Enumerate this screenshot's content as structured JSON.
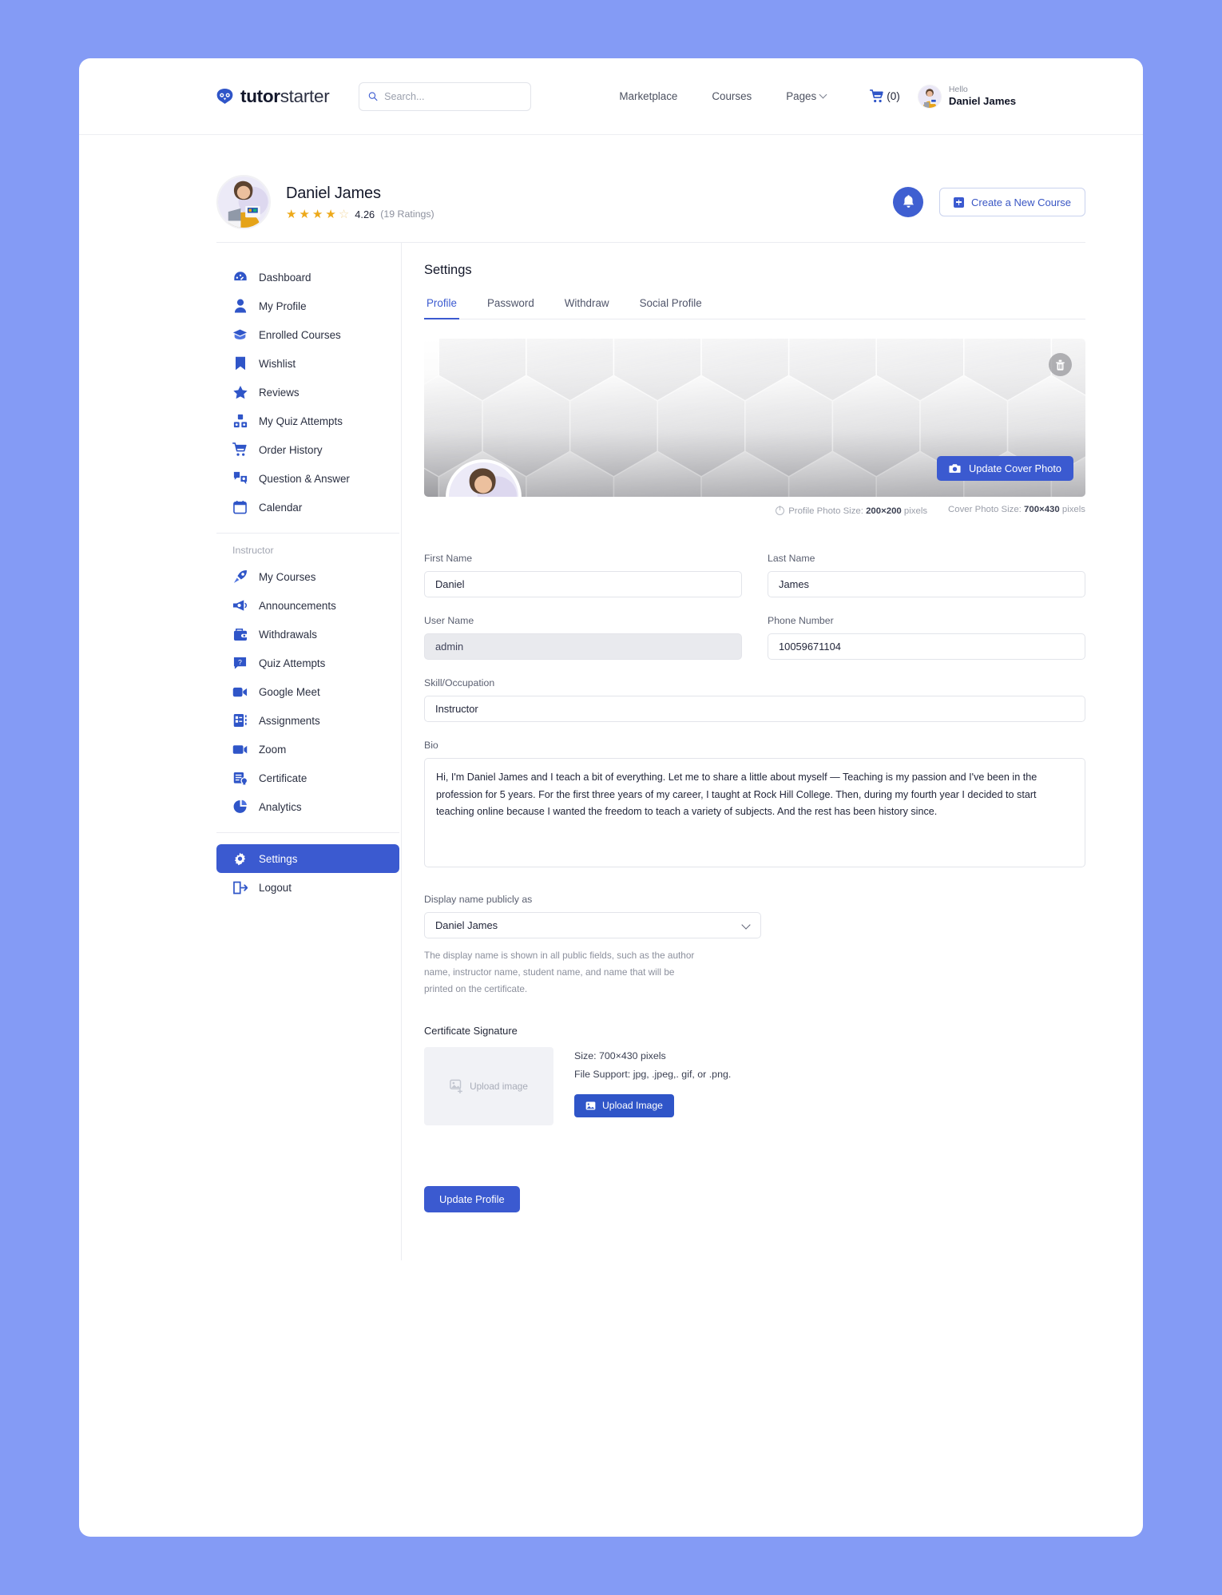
{
  "brand": {
    "bold": "tutor",
    "light": "starter",
    "icon": "owl-logo-icon"
  },
  "search": {
    "placeholder": "Search...",
    "value": ""
  },
  "nav": {
    "links": [
      {
        "label": "Marketplace",
        "has_caret": false
      },
      {
        "label": "Courses",
        "has_caret": false
      },
      {
        "label": "Pages",
        "has_caret": true
      }
    ],
    "cart_label": "(0)",
    "hello": "Hello",
    "user_name": "Daniel James"
  },
  "profile_header": {
    "name": "Daniel James",
    "rating_value": "4.26",
    "rating_count": "(19 Ratings)",
    "stars_filled": 4,
    "stars_total": 5,
    "notification_icon": "bell-icon",
    "create_course_label": "Create a New Course"
  },
  "sidebar": {
    "student_items": [
      {
        "label": "Dashboard",
        "icon": "dashboard-icon"
      },
      {
        "label": "My Profile",
        "icon": "user-icon"
      },
      {
        "label": "Enrolled Courses",
        "icon": "graduation-cap-icon"
      },
      {
        "label": "Wishlist",
        "icon": "bookmark-icon"
      },
      {
        "label": "Reviews",
        "icon": "star-icon"
      },
      {
        "label": "My Quiz Attempts",
        "icon": "quiz-icon"
      },
      {
        "label": "Order History",
        "icon": "cart-icon"
      },
      {
        "label": "Question & Answer",
        "icon": "question-answer-icon"
      },
      {
        "label": "Calendar",
        "icon": "calendar-icon"
      }
    ],
    "group_title": "Instructor",
    "instructor_items": [
      {
        "label": "My Courses",
        "icon": "rocket-icon"
      },
      {
        "label": "Announcements",
        "icon": "megaphone-icon"
      },
      {
        "label": "Withdrawals",
        "icon": "wallet-icon"
      },
      {
        "label": "Quiz Attempts",
        "icon": "quiz-question-icon"
      },
      {
        "label": "Google Meet",
        "icon": "video-camera-icon"
      },
      {
        "label": "Assignments",
        "icon": "assignment-list-icon"
      },
      {
        "label": "Zoom",
        "icon": "zoom-camera-icon"
      },
      {
        "label": "Certificate",
        "icon": "certificate-icon"
      },
      {
        "label": "Analytics",
        "icon": "pie-chart-icon"
      }
    ],
    "footer_items": [
      {
        "label": "Settings",
        "icon": "gear-icon",
        "active": true
      },
      {
        "label": "Logout",
        "icon": "logout-icon",
        "active": false
      }
    ]
  },
  "settings": {
    "title": "Settings",
    "tabs": [
      {
        "label": "Profile",
        "active": true
      },
      {
        "label": "Password",
        "active": false
      },
      {
        "label": "Withdraw",
        "active": false
      },
      {
        "label": "Social Profile",
        "active": false
      }
    ],
    "cover": {
      "delete_icon": "trash-icon",
      "update_icon": "camera-icon",
      "update_label": "Update Cover Photo"
    },
    "size_hints": {
      "profile_prefix": "Profile Photo Size:",
      "profile_value": "200×200",
      "profile_suffix": "pixels",
      "cover_prefix": "Cover Photo Size:",
      "cover_value": "700×430",
      "cover_suffix": "pixels"
    },
    "fields": {
      "first_name_label": "First Name",
      "first_name_value": "Daniel",
      "last_name_label": "Last Name",
      "last_name_value": "James",
      "user_name_label": "User Name",
      "user_name_value": "admin",
      "phone_label": "Phone Number",
      "phone_value": "10059671104",
      "skill_label": "Skill/Occupation",
      "skill_value": "Instructor",
      "bio_label": "Bio",
      "bio_value": "Hi, I'm Daniel James and I teach a bit of everything. Let me to share a little about myself — Teaching is my passion and I've been in the profession for 5 years. For the first three years of my career, I taught at Rock Hill College. Then, during my fourth year I decided to start teaching online because I wanted the freedom to teach a variety of subjects. And the rest has been history since.",
      "display_name_label": "Display name publicly as",
      "display_name_value": "Daniel James",
      "display_name_helper": "The display name is shown in all public fields, such as the author name, instructor name, student name, and name that will be printed on the certificate."
    },
    "certificate": {
      "title": "Certificate Signature",
      "upload_placeholder": "Upload image",
      "upload_placeholder_icon": "image-upload-icon",
      "size_text": "Size: 700×430 pixels",
      "file_support_text": "File Support: jpg, .jpeg,. gif, or .png.",
      "upload_button_label": "Upload Image",
      "upload_button_icon": "image-icon"
    },
    "submit_label": "Update Profile"
  },
  "colors": {
    "page_background": "#849bf5",
    "accent": "#3b5ad0",
    "star": "#eda91a",
    "readonly_field": "#e9eaee"
  }
}
